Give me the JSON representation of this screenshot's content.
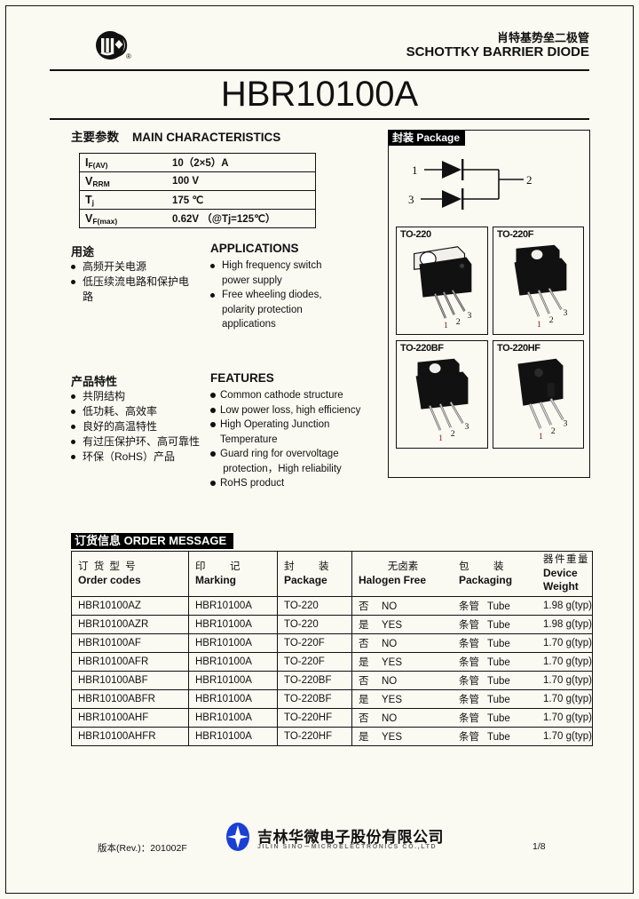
{
  "header": {
    "logo_icon": "sino-microelectronics-circle-logo",
    "registered_mark": "®",
    "title_cn": "肖特基势垒二极管",
    "title_en": "SCHOTTKY BARRIER DIODE",
    "part_number": "HBR10100A"
  },
  "main_characteristics": {
    "section_title_cn": "主要参数",
    "section_title_en": "MAIN   CHARACTERISTICS",
    "rows": [
      {
        "symbol": "I",
        "subscript": "F(AV)",
        "value": "10（2×5）A"
      },
      {
        "symbol": "V",
        "subscript": "RRM",
        "value": "100 V"
      },
      {
        "symbol": "T",
        "subscript": "j",
        "value": "175 ℃"
      },
      {
        "symbol": "V",
        "subscript": "F(max)",
        "value": "0.62V  （@Tj=125℃）"
      }
    ]
  },
  "applications": {
    "head_cn": "用途",
    "head_en": "APPLICATIONS",
    "items_cn": [
      "高频开关电源",
      "低压续流电路和保护电",
      "路"
    ],
    "items_en": [
      "High frequency switch",
      "power supply",
      "Free wheeling diodes,",
      "polarity protection",
      "applications"
    ]
  },
  "features": {
    "head_cn": "产品特性",
    "head_en": "FEATURES",
    "items_cn": [
      "共阴结构",
      "低功耗、高效率",
      "良好的高温特性",
      "有过压保护环、高可靠性",
      "环保（RoHS）产品"
    ],
    "items_en": [
      "Common cathode structure",
      "Low power loss, high efficiency",
      "High Operating Junction",
      "Temperature",
      "Guard ring for overvoltage",
      "protection，High reliability",
      "RoHS product"
    ]
  },
  "package": {
    "banner_cn": "封装",
    "banner_en": "Package",
    "schematic": {
      "pin_1": "1",
      "pin_2": "2",
      "pin_3": "3",
      "description": "common-cathode dual diode"
    },
    "boxes": [
      {
        "label": "TO-220",
        "pins": [
          "1",
          "2",
          "3"
        ]
      },
      {
        "label": "TO-220F",
        "pins": [
          "1",
          "2",
          "3"
        ]
      },
      {
        "label": "TO-220BF",
        "pins": [
          "1",
          "2",
          "3"
        ]
      },
      {
        "label": "TO-220HF",
        "pins": [
          "1",
          "2",
          "3"
        ]
      }
    ]
  },
  "order_message": {
    "banner_cn": "订货信息",
    "banner_en": "ORDER MESSAGE",
    "headers": [
      {
        "cn": "订 货 型 号",
        "en": "Order codes"
      },
      {
        "cn": "印　　记",
        "en": "Marking"
      },
      {
        "cn": "封　　装",
        "en": "Package"
      },
      {
        "cn": "无卤素",
        "en": "Halogen Free"
      },
      {
        "cn": "包　　装",
        "en": "Packaging"
      },
      {
        "cn": "器件重量",
        "en": "Device Weight"
      }
    ],
    "rows": [
      {
        "code": "HBR10100AZ",
        "marking": "HBR10100A",
        "package": "TO-220",
        "halogen_cn": "否",
        "halogen_en": "NO",
        "packaging_cn": "条管",
        "packaging_en": "Tube",
        "weight": "1.98 g(typ)"
      },
      {
        "code": "HBR10100AZR",
        "marking": "HBR10100A",
        "package": "TO-220",
        "halogen_cn": "是",
        "halogen_en": "YES",
        "packaging_cn": "条管",
        "packaging_en": "Tube",
        "weight": "1.98 g(typ)"
      },
      {
        "code": "HBR10100AF",
        "marking": "HBR10100A",
        "package": "TO-220F",
        "halogen_cn": "否",
        "halogen_en": "NO",
        "packaging_cn": "条管",
        "packaging_en": "Tube",
        "weight": "1.70 g(typ)"
      },
      {
        "code": "HBR10100AFR",
        "marking": "HBR10100A",
        "package": "TO-220F",
        "halogen_cn": "是",
        "halogen_en": "YES",
        "packaging_cn": "条管",
        "packaging_en": "Tube",
        "weight": "1.70 g(typ)"
      },
      {
        "code": "HBR10100ABF",
        "marking": "HBR10100A",
        "package": "TO-220BF",
        "halogen_cn": "否",
        "halogen_en": "NO",
        "packaging_cn": "条管",
        "packaging_en": "Tube",
        "weight": "1.70 g(typ)"
      },
      {
        "code": "HBR10100ABFR",
        "marking": "HBR10100A",
        "package": "TO-220BF",
        "halogen_cn": "是",
        "halogen_en": "YES",
        "packaging_cn": "条管",
        "packaging_en": "Tube",
        "weight": "1.70 g(typ)"
      },
      {
        "code": "HBR10100AHF",
        "marking": "HBR10100A",
        "package": "TO-220HF",
        "halogen_cn": "否",
        "halogen_en": "NO",
        "packaging_cn": "条管",
        "packaging_en": "Tube",
        "weight": "1.70 g(typ)"
      },
      {
        "code": "HBR10100AHFR",
        "marking": "HBR10100A",
        "package": "TO-220HF",
        "halogen_cn": "是",
        "halogen_en": "YES",
        "packaging_cn": "条管",
        "packaging_en": "Tube",
        "weight": "1.70 g(typ)"
      }
    ]
  },
  "footer": {
    "revision": "版本(Rev.)：201002F",
    "company_cn": "吉林华微电子股份有限公司",
    "company_en": "JILIN  SINO－MICROELECTRONICS   CO.,LTD",
    "page": "1/8",
    "logo_icon": "sino-star-ellipse-logo"
  },
  "colors": {
    "page_background": "#faf9f2",
    "ink": "#111111",
    "logo_blue": "#1a3fd4",
    "banner_background": "#000000",
    "banner_text": "#ffffff"
  }
}
